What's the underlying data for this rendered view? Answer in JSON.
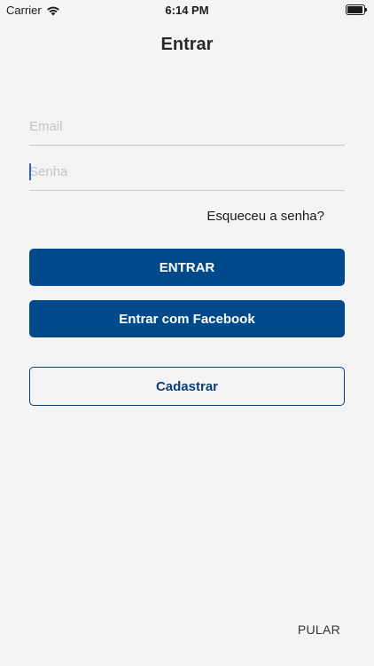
{
  "status_bar": {
    "carrier": "Carrier",
    "time": "6:14 PM",
    "icons": [
      "wifi-icon",
      "battery-icon"
    ]
  },
  "header": {
    "title": "Entrar"
  },
  "form": {
    "email": {
      "value": "",
      "placeholder": "Email"
    },
    "password": {
      "value": "",
      "placeholder": "Senha"
    },
    "forgot_password_label": "Esqueceu a senha?"
  },
  "actions": {
    "login_label": "ENTRAR",
    "facebook_label": "Entrar com Facebook",
    "signup_label": "Cadastrar",
    "skip_label": "PULAR"
  },
  "colors": {
    "primary": "#004a8c",
    "outline": "#0a3f7a",
    "background": "#f4f4f4",
    "cursor": "#2b63d8"
  }
}
